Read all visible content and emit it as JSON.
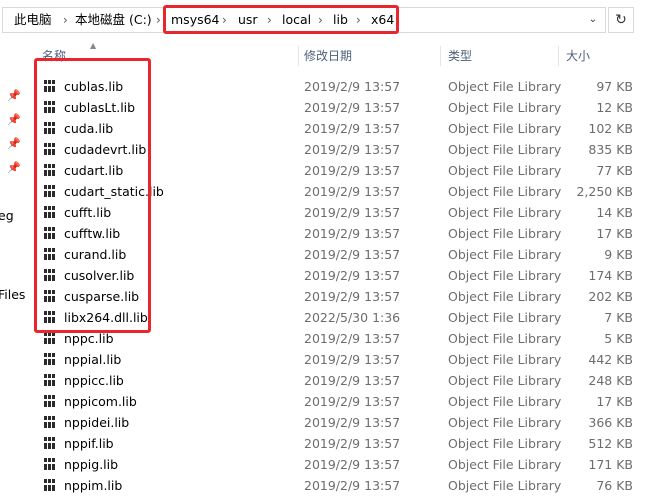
{
  "address": {
    "crumbs": [
      "此电脑",
      "本地磁盘 (C:)",
      "msys64",
      "usr",
      "local",
      "lib",
      "x64"
    ],
    "separator": "›",
    "dropdown_glyph": "⌄",
    "refresh_glyph": "↻"
  },
  "nav": {
    "fragments": [
      "eg",
      "Files"
    ]
  },
  "columns": {
    "name": "名称",
    "date": "修改日期",
    "type": "类型",
    "size": "大小"
  },
  "files": [
    {
      "name": "cublas.lib",
      "date": "2019/2/9 13:57",
      "type": "Object File Library",
      "size": "97 KB"
    },
    {
      "name": "cublasLt.lib",
      "date": "2019/2/9 13:57",
      "type": "Object File Library",
      "size": "12 KB"
    },
    {
      "name": "cuda.lib",
      "date": "2019/2/9 13:57",
      "type": "Object File Library",
      "size": "102 KB"
    },
    {
      "name": "cudadevrt.lib",
      "date": "2019/2/9 13:57",
      "type": "Object File Library",
      "size": "835 KB"
    },
    {
      "name": "cudart.lib",
      "date": "2019/2/9 13:57",
      "type": "Object File Library",
      "size": "77 KB"
    },
    {
      "name": "cudart_static.lib",
      "date": "2019/2/9 13:57",
      "type": "Object File Library",
      "size": "2,250 KB"
    },
    {
      "name": "cufft.lib",
      "date": "2019/2/9 13:57",
      "type": "Object File Library",
      "size": "14 KB"
    },
    {
      "name": "cufftw.lib",
      "date": "2019/2/9 13:57",
      "type": "Object File Library",
      "size": "17 KB"
    },
    {
      "name": "curand.lib",
      "date": "2019/2/9 13:57",
      "type": "Object File Library",
      "size": "9 KB"
    },
    {
      "name": "cusolver.lib",
      "date": "2019/2/9 13:57",
      "type": "Object File Library",
      "size": "174 KB"
    },
    {
      "name": "cusparse.lib",
      "date": "2019/2/9 13:57",
      "type": "Object File Library",
      "size": "202 KB"
    },
    {
      "name": "libx264.dll.lib",
      "date": "2022/5/30 1:36",
      "type": "Object File Library",
      "size": "7 KB"
    },
    {
      "name": "nppc.lib",
      "date": "2019/2/9 13:57",
      "type": "Object File Library",
      "size": "5 KB"
    },
    {
      "name": "nppial.lib",
      "date": "2019/2/9 13:57",
      "type": "Object File Library",
      "size": "442 KB"
    },
    {
      "name": "nppicc.lib",
      "date": "2019/2/9 13:57",
      "type": "Object File Library",
      "size": "248 KB"
    },
    {
      "name": "nppicom.lib",
      "date": "2019/2/9 13:57",
      "type": "Object File Library",
      "size": "17 KB"
    },
    {
      "name": "nppidei.lib",
      "date": "2019/2/9 13:57",
      "type": "Object File Library",
      "size": "366 KB"
    },
    {
      "name": "nppif.lib",
      "date": "2019/2/9 13:57",
      "type": "Object File Library",
      "size": "512 KB"
    },
    {
      "name": "nppig.lib",
      "date": "2019/2/9 13:57",
      "type": "Object File Library",
      "size": "171 KB"
    },
    {
      "name": "nppim.lib",
      "date": "2019/2/9 13:57",
      "type": "Object File Library",
      "size": "76 KB"
    }
  ],
  "colors": {
    "highlight": "#e8262b",
    "header_text": "#4c607a",
    "meta_text": "#6d6d6d"
  },
  "icons": {
    "file": "library-file-icon",
    "pin": "pin-icon"
  }
}
